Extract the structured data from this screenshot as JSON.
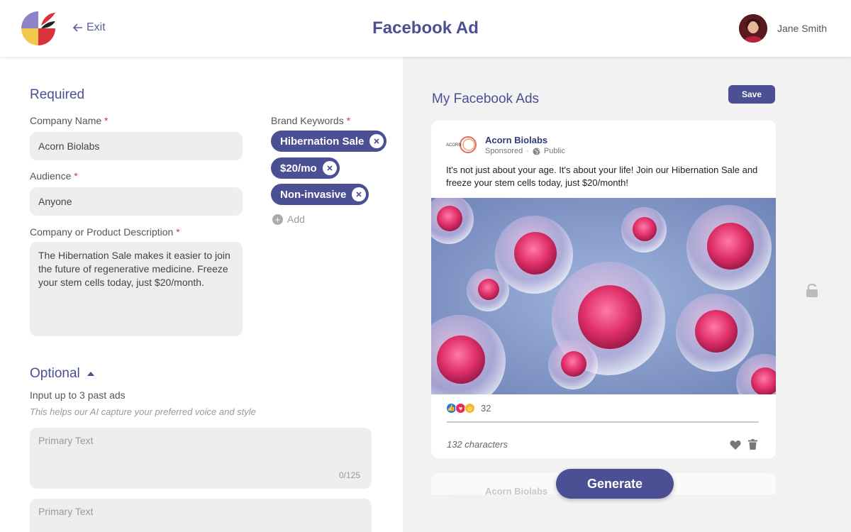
{
  "header": {
    "exit_label": "Exit",
    "title": "Facebook Ad",
    "user_name": "Jane Smith"
  },
  "required": {
    "title": "Required",
    "company_name": {
      "label": "Company Name",
      "value": "Acorn Biolabs"
    },
    "audience": {
      "label": "Audience",
      "value": "Anyone"
    },
    "description": {
      "label": "Company or Product Description",
      "value": "The Hibernation Sale makes it easier to join the future of regenerative medicine. Freeze your stem cells today, just $20/month."
    },
    "keywords": {
      "label": "Brand Keywords",
      "chips": [
        "Hibernation Sale",
        "$20/mo",
        "Non-invasive"
      ],
      "add_label": "Add"
    },
    "asterisk": "*"
  },
  "optional": {
    "title": "Optional",
    "subtitle": "Input up to 3 past ads",
    "hint": "This helps our AI capture your preferred voice and style",
    "past_ads": [
      {
        "placeholder": "Primary Text",
        "counter": "0/125"
      },
      {
        "placeholder": "Primary Text"
      }
    ]
  },
  "ads_panel": {
    "title": "My Facebook Ads",
    "save_label": "Save",
    "generate_label": "Generate",
    "card": {
      "company": "Acorn Biolabs",
      "sponsored": "Sponsored",
      "dot": "·",
      "visibility": "Public",
      "logo_text": "ACORN",
      "text": "It's not just about your age. It's about your life! Join our Hibernation Sale and freeze your stem cells today, just $20/month!",
      "reaction_count": "32",
      "char_count": "132 characters"
    },
    "card2_company": "Acorn Biolabs"
  },
  "colors": {
    "accent": "#4b4f93",
    "required_mark": "#dd3333",
    "field_bg": "#eeeeee",
    "panel_bg": "#f2f2f2"
  },
  "icons": [
    "logo",
    "arrow-left-icon",
    "avatar",
    "close-icon",
    "plus-circle-icon",
    "caret-up-icon",
    "globe-icon",
    "like-icon",
    "love-icon",
    "wow-icon",
    "heart-icon",
    "trash-icon",
    "lock-icon"
  ]
}
